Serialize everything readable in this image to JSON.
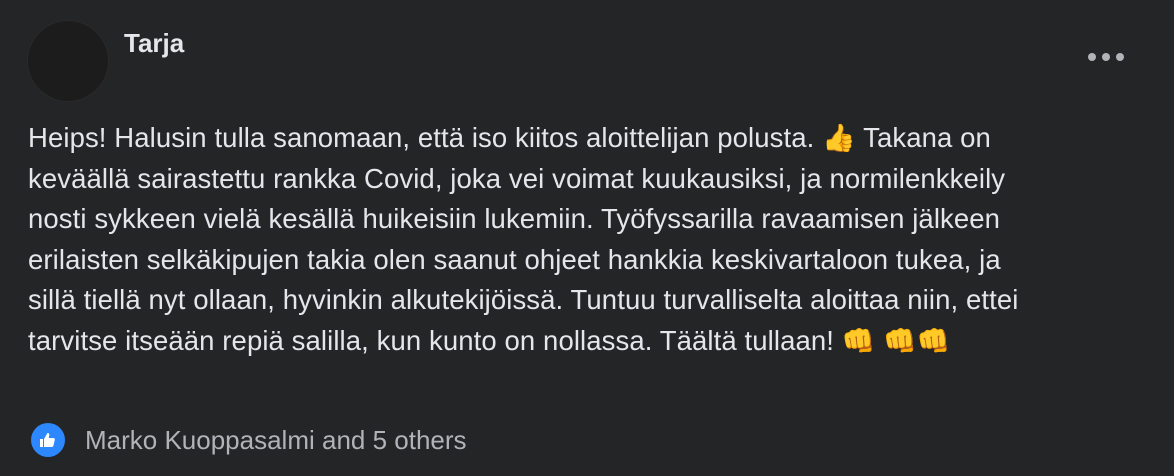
{
  "post": {
    "author": "Tarja",
    "more_icon": "ellipsis-icon",
    "body_lines": [
      {
        "text": "Heips! Halusin tulla sanomaan, että iso kiitos aloittelijan polusta. ",
        "emoji": "👍",
        "text_after": " Takana on"
      },
      {
        "text": "keväällä sairastettu rankka Covid, joka vei voimat kuukausiksi, ja normilenkkeily"
      },
      {
        "text": "nosti sykkeen vielä kesällä huikeisiin lukemiin. Työfyssarilla ravaamisen jälkeen"
      },
      {
        "text": "erilaisten selkäkipujen takia olen saanut ohjeet hankkia keskivartaloon tukea, ja"
      },
      {
        "text": "sillä tiellä nyt ollaan, hyvinkin alkutekijöissä. Tuntuu turvalliselta aloittaa niin, ettei"
      },
      {
        "text": "tarvitse itseään repiä salilla, kun kunto on nollassa. Täältä tullaan! ",
        "emoji": "👊 👊👊"
      }
    ],
    "reactions": {
      "icon": "like-icon",
      "text": "Marko Kuoppasalmi and 5 others"
    }
  },
  "colors": {
    "background": "#242526",
    "primary_text": "#e4e6eb",
    "secondary_text": "#b0b3b8",
    "like_blue": "#2d88ff"
  }
}
